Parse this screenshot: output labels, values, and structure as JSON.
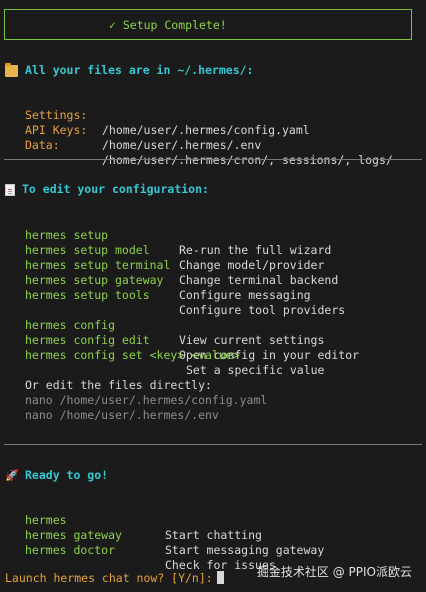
{
  "banner": "✓ Setup Complete!",
  "files": {
    "heading": "All your files are in ~/.hermes/:",
    "rows": [
      {
        "key": "Settings:",
        "value": "/home/user/.hermes/config.yaml"
      },
      {
        "key": "API Keys:",
        "value": "/home/user/.hermes/.env"
      },
      {
        "key": "Data:",
        "value": "/home/user/.hermes/cron/, sessions/, logs/"
      }
    ]
  },
  "config": {
    "heading": "To edit your configuration:",
    "setup": [
      {
        "cmd": "hermes setup",
        "desc": "Re-run the full wizard"
      },
      {
        "cmd": "hermes setup model",
        "desc": "Change model/provider"
      },
      {
        "cmd": "hermes setup terminal",
        "desc": "Change terminal backend"
      },
      {
        "cmd": "hermes setup gateway",
        "desc": "Configure messaging"
      },
      {
        "cmd": "hermes setup tools",
        "desc": "Configure tool providers"
      }
    ],
    "cfg": [
      {
        "cmd": "hermes config",
        "desc": "View current settings"
      },
      {
        "cmd": "hermes config edit",
        "desc": "Open config in your editor"
      }
    ],
    "set_cmd": "hermes config set <key> <value>",
    "set_desc": "Set a specific value",
    "edit_note": "Or edit the files directly:",
    "nano": [
      "nano /home/user/.hermes/config.yaml",
      "nano /home/user/.hermes/.env"
    ]
  },
  "ready": {
    "heading": "Ready to go!",
    "rows": [
      {
        "cmd": "hermes",
        "desc": "Start chatting"
      },
      {
        "cmd": "hermes gateway",
        "desc": "Start messaging gateway"
      },
      {
        "cmd": "hermes doctor",
        "desc": "Check for issues"
      }
    ]
  },
  "prompt": "Launch hermes chat now? [Y/n]:",
  "watermark": "掘金技术社区 @ PPIO派欧云",
  "icons": {
    "files": "folder-icon",
    "config": "document-icon",
    "ready": "rocket-icon"
  },
  "colors": {
    "green": "#8ed14a",
    "cyan": "#36c8d2",
    "orange": "#e6a23c",
    "gray": "#8c8c8c",
    "bg": "#1b1b1b"
  }
}
